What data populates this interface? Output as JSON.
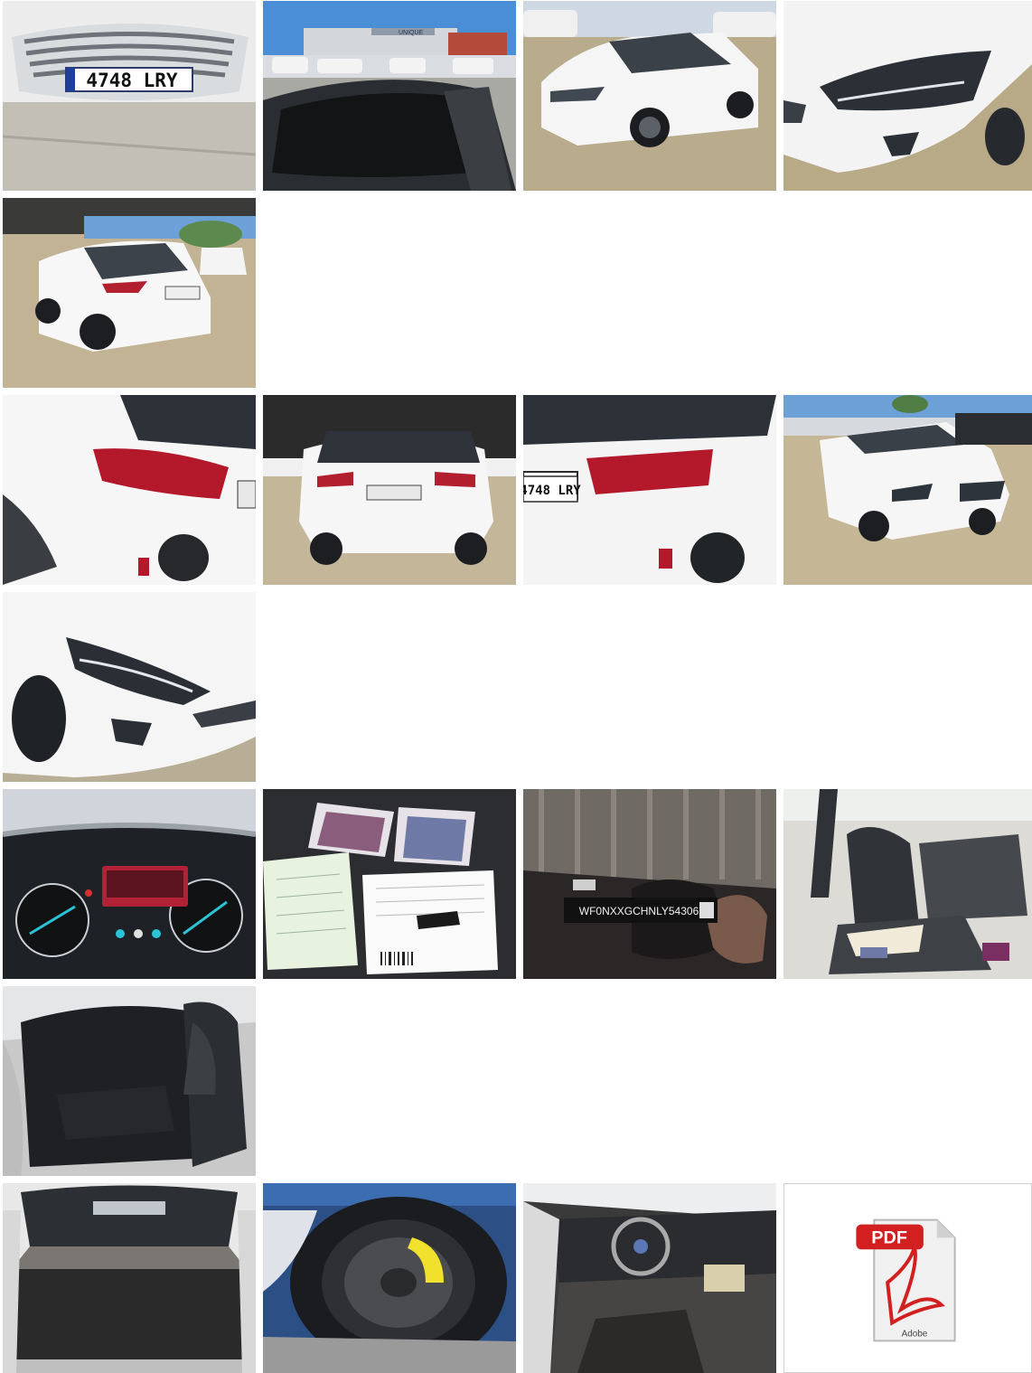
{
  "gallery": {
    "photos": [
      {
        "name": "front-bumper-plate-photo",
        "plate": "4748 LRY"
      },
      {
        "name": "car-roof-lot-photo",
        "sign": "UNIQUE"
      },
      {
        "name": "front-three-quarter-photo"
      },
      {
        "name": "right-headlight-photo"
      },
      {
        "name": "rear-left-view-photo"
      },
      {
        "name": "rear-left-taillight-photo"
      },
      {
        "name": "rear-view-garage-photo"
      },
      {
        "name": "rear-plate-closeup-photo",
        "plate": "4748 LRY"
      },
      {
        "name": "front-left-lot-photo"
      },
      {
        "name": "left-headlight-closeup-photo"
      },
      {
        "name": "instrument-cluster-photo"
      },
      {
        "name": "documents-and-key-photo"
      },
      {
        "name": "vin-windshield-photo",
        "vin": "WF0NXXGCHNLY54306"
      },
      {
        "name": "front-seats-interior-photo"
      },
      {
        "name": "rear-seats-interior-photo"
      },
      {
        "name": "open-trunk-photo"
      },
      {
        "name": "spare-wheel-photo"
      },
      {
        "name": "dashboard-interior-photo"
      }
    ],
    "pdf": {
      "badge": "PDF",
      "brand": "Adobe"
    }
  }
}
